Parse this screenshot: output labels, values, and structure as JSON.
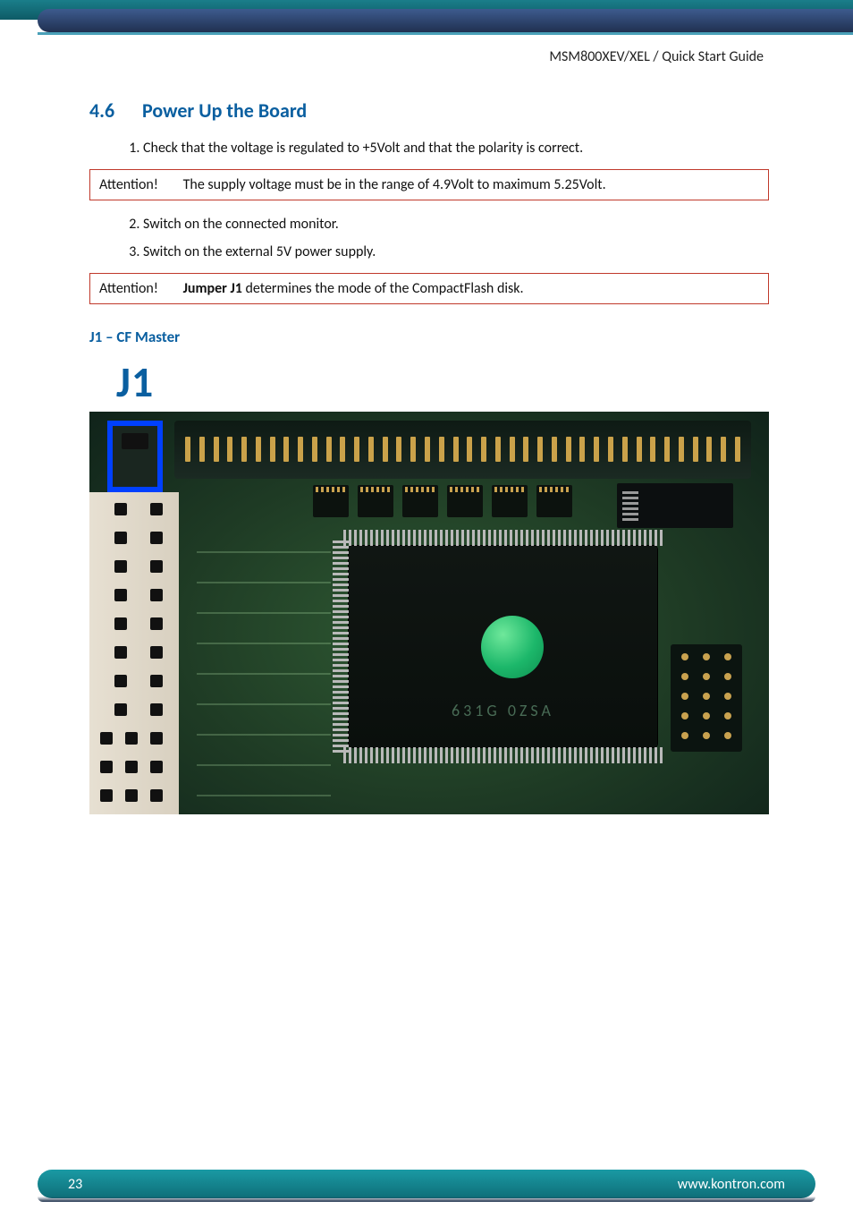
{
  "header": {
    "doc_title": "MSM800XEV/XEL / Quick Start Guide"
  },
  "section": {
    "number": "4.6",
    "title": "Power Up the Board"
  },
  "steps": {
    "s1": "Check that the voltage is regulated to +5Volt and that the polarity is correct.",
    "s2": "Switch on the connected monitor.",
    "s3": "Switch on the external 5V power supply."
  },
  "attention1": {
    "label": "Attention!",
    "text": "The supply voltage must be in the range of 4.9Volt to maximum 5.25Volt."
  },
  "attention2": {
    "label": "Attention!",
    "bold": "Jumper J1",
    "text": " determines the mode of the CompactFlash disk."
  },
  "subheading": "J1 – CF Master",
  "figure": {
    "label": "J1",
    "chip_text": "631G        0ZSA"
  },
  "footer": {
    "page": "23",
    "url": "www.kontron.com"
  }
}
